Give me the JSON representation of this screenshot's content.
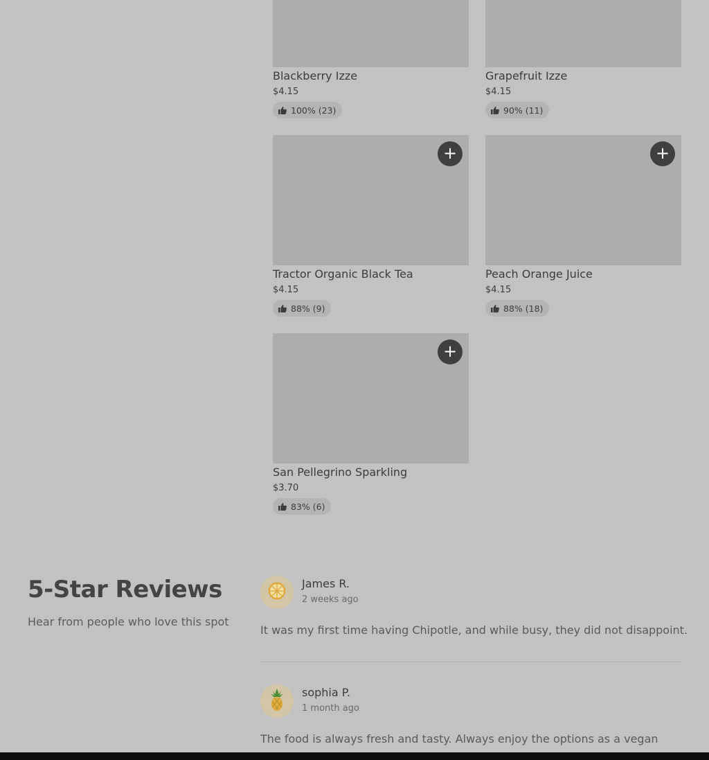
{
  "products": [
    {
      "name": "Blackberry Izze",
      "price": "$4.15",
      "rating": "100% (23)",
      "add_label": "+"
    },
    {
      "name": "Grapefruit Izze",
      "price": "$4.15",
      "rating": "90% (11)",
      "add_label": "+"
    },
    {
      "name": "Tractor Organic Black Tea",
      "price": "$4.15",
      "rating": "88% (9)",
      "add_label": "+"
    },
    {
      "name": "Peach Orange Juice",
      "price": "$4.15",
      "rating": "88% (18)",
      "add_label": "+"
    },
    {
      "name": "San Pellegrino Sparkling",
      "price": "$3.70",
      "rating": "83% (6)",
      "add_label": "+"
    }
  ],
  "reviews_section": {
    "title": "5-Star Reviews",
    "subtitle": "Hear from people who love this spot",
    "reviews": [
      {
        "name": "James R.",
        "time": "2 weeks ago",
        "text": "It was my first time having Chipotle, and while busy, they did not disappoint.",
        "avatar_icon": "citrus-slice-icon"
      },
      {
        "name": "sophia P.",
        "time": "1 month ago",
        "text": "The food is always fresh and tasty. Always enjoy the options as a vegan",
        "avatar_icon": "pineapple-icon"
      }
    ]
  },
  "colors": {
    "background": "#c2c2c2",
    "image_placeholder": "#adadad",
    "add_button": "#3f3f3f",
    "rating_pill": "#b4b4b4",
    "avatar_bg": "#d2c6a6"
  }
}
